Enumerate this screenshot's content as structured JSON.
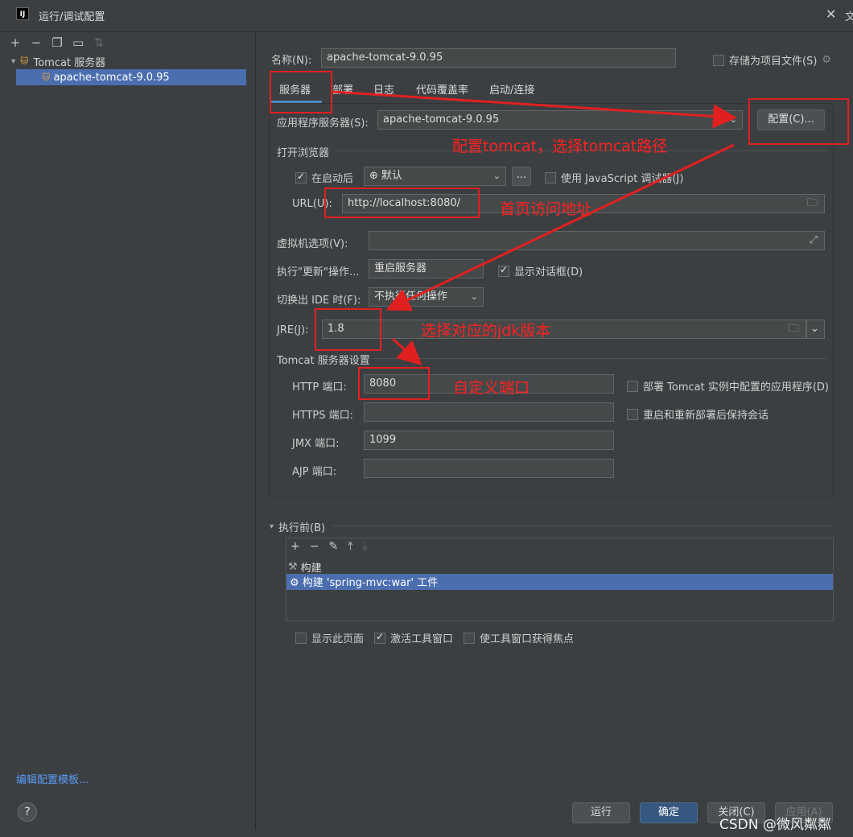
{
  "window": {
    "title": "运行/调试配置",
    "app_icon": "IJ",
    "clipped_text": "文"
  },
  "left": {
    "group_label": "Tomcat 服务器",
    "selected_config": "apache-tomcat-9.0.95",
    "edit_templates": "编辑配置模板...",
    "help": "?"
  },
  "name_row": {
    "label": "名称(N):",
    "value": "apache-tomcat-9.0.95",
    "store_label": "存储为项目文件(S)"
  },
  "tabs": [
    "服务器",
    "部署",
    "日志",
    "代码覆盖率",
    "启动/连接"
  ],
  "server": {
    "app_server_label": "应用程序服务器(S):",
    "app_server_value": "apache-tomcat-9.0.95",
    "configure_button": "配置(C)...",
    "open_browser_label": "打开浏览器",
    "after_launch_label": "在启动后",
    "browser_value": "默认",
    "dots_button": "...",
    "js_debugger_label": "使用 JavaScript 调试器(J)",
    "url_label": "URL(U):",
    "url_value": "http://localhost:8080/",
    "vm_options_label": "虚拟机选项(V):",
    "update_action_label": "执行\"更新\"操作...",
    "update_action_value": "重启服务器",
    "show_dialog_label": "显示对话框(D)",
    "frame_deactivation_label": "切换出 IDE 时(F):",
    "frame_deactivation_value": "不执行任何操作",
    "jre_label": "JRE(J):",
    "jre_value": "1.8",
    "tomcat_settings_label": "Tomcat 服务器设置",
    "http_port_label": "HTTP 端口:",
    "http_port_value": "8080",
    "https_port_label": "HTTPS 端口:",
    "https_port_value": "",
    "jmx_port_label": "JMX 端口:",
    "jmx_port_value": "1099",
    "ajp_port_label": "AJP 端口:",
    "ajp_port_value": "",
    "deploy_apps_label": "部署 Tomcat 实例中配置的应用程序(D)",
    "preserve_sessions_label": "重启和重新部署后保持会话"
  },
  "before_launch": {
    "label": "执行前(B)",
    "items": [
      "构建",
      "构建 'spring-mvc:war' 工件"
    ]
  },
  "bottom_checks": {
    "show_page": "显示此页面",
    "activate_tool_window": "激活工具窗口",
    "focus_tool_window": "使工具窗口获得焦点"
  },
  "buttons": {
    "run": "运行",
    "ok": "确定",
    "close": "关闭(C)",
    "apply": "应用(A)"
  },
  "annotations": {
    "configure_tomcat": "配置tomcat，选择tomcat路径",
    "homepage_url": "首页访问地址",
    "choose_jdk": "选择对应的jdk版本",
    "custom_port": "自定义端口"
  },
  "watermark": "CSDN @微风粼粼",
  "colors": {
    "background": "#3c3f41",
    "selection": "#4b6eaf",
    "primary_button": "#365880",
    "annotation_red": "#e02020"
  }
}
